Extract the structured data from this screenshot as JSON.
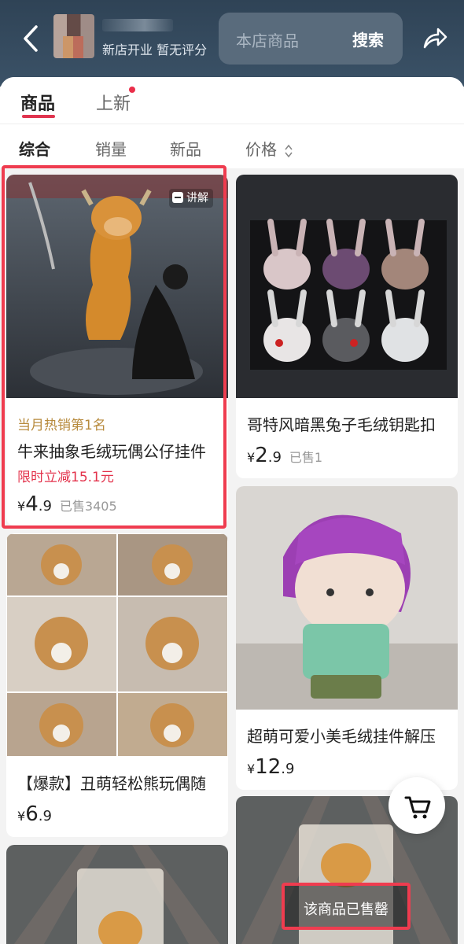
{
  "header": {
    "shop_meta": "新店开业 暂无评分",
    "search_placeholder": "本店商品",
    "search_button": "搜索"
  },
  "tabs": [
    {
      "label": "商品",
      "active": true
    },
    {
      "label": "上新",
      "has_dot": true
    }
  ],
  "sort": [
    "综合",
    "销量",
    "新品",
    "价格"
  ],
  "products": [
    {
      "title": "",
      "hot": "当月热销第1名",
      "name": "牛来抽象毛绒玩偶公仔挂件",
      "promo": "限时立减15.1元",
      "price_int": "4",
      "price_dec": ".9",
      "sold": "已售3405",
      "badge": "讲解"
    },
    {
      "name": "哥特风暗黑兔子毛绒钥匙扣",
      "price_int": "2",
      "price_dec": ".9",
      "sold": "已售1"
    },
    {
      "name": "【爆款】丑萌轻松熊玩偶随",
      "price_int": "6",
      "price_dec": ".9",
      "sold": ""
    },
    {
      "name": "超萌可爱小美毛绒挂件解压",
      "price_int": "12",
      "price_dec": ".9",
      "sold": ""
    }
  ],
  "currency": "¥",
  "soldout_label": "该商品已售罄",
  "icons": [
    "back-icon",
    "share-icon",
    "cart-icon",
    "sort-caret-icon",
    "explain-icon"
  ],
  "colors": {
    "accent": "#e0344f",
    "header_bg": "#34495d",
    "hot_text": "#b78a3c"
  }
}
